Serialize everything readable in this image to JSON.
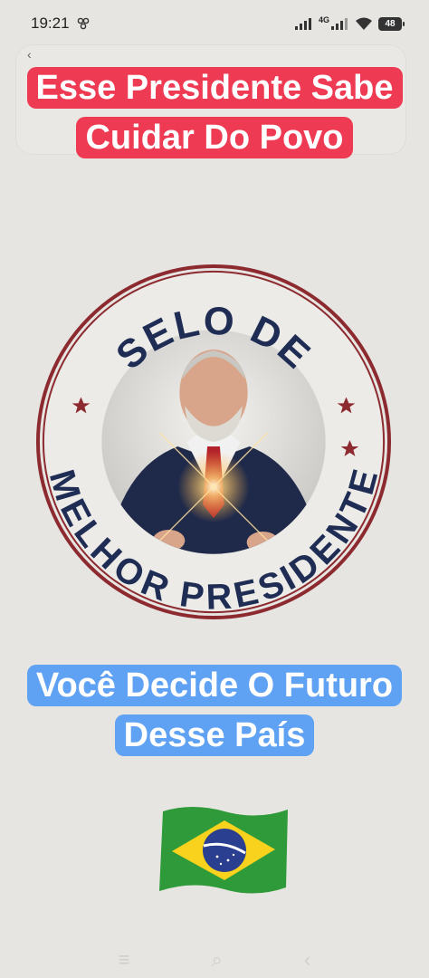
{
  "status_bar": {
    "time": "19:21",
    "network": "4G",
    "battery": "48"
  },
  "captions": {
    "top": "Esse Presidente Sabe Cuidar Do Povo",
    "bottom": "Você Decide O Futuro Desse País"
  },
  "seal": {
    "top_text": "SELO DE",
    "bottom_text": "MELHOR PRESIDENTE",
    "ring_color": "#8c2a2f",
    "text_color": "#1f2d55"
  },
  "flag": {
    "icon": "brazil-flag-emoji"
  },
  "colors": {
    "caption_top_bg": "#ee3a52",
    "caption_bottom_bg": "#5fa2f3",
    "background": "#e6e5e1"
  }
}
